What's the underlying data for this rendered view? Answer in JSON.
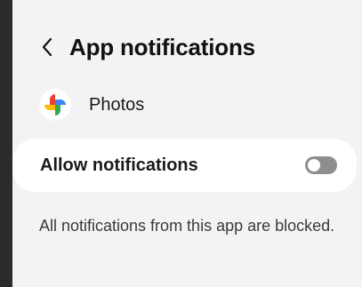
{
  "header": {
    "back_icon": "chevron-left-icon",
    "title": "App notifications"
  },
  "app": {
    "icon": "google-photos-pinwheel-icon",
    "name": "Photos"
  },
  "allow_setting": {
    "label": "Allow notifications",
    "enabled": false
  },
  "description": "All notifications from this app are blocked.",
  "colors": {
    "screen_background": "#f3f3f5",
    "card_background": "#ffffff",
    "toggle_off": "#8e8e8e",
    "photos_red": "#ea4335",
    "photos_yellow": "#fbbc04",
    "photos_green": "#34a853",
    "photos_blue": "#4285f4"
  }
}
